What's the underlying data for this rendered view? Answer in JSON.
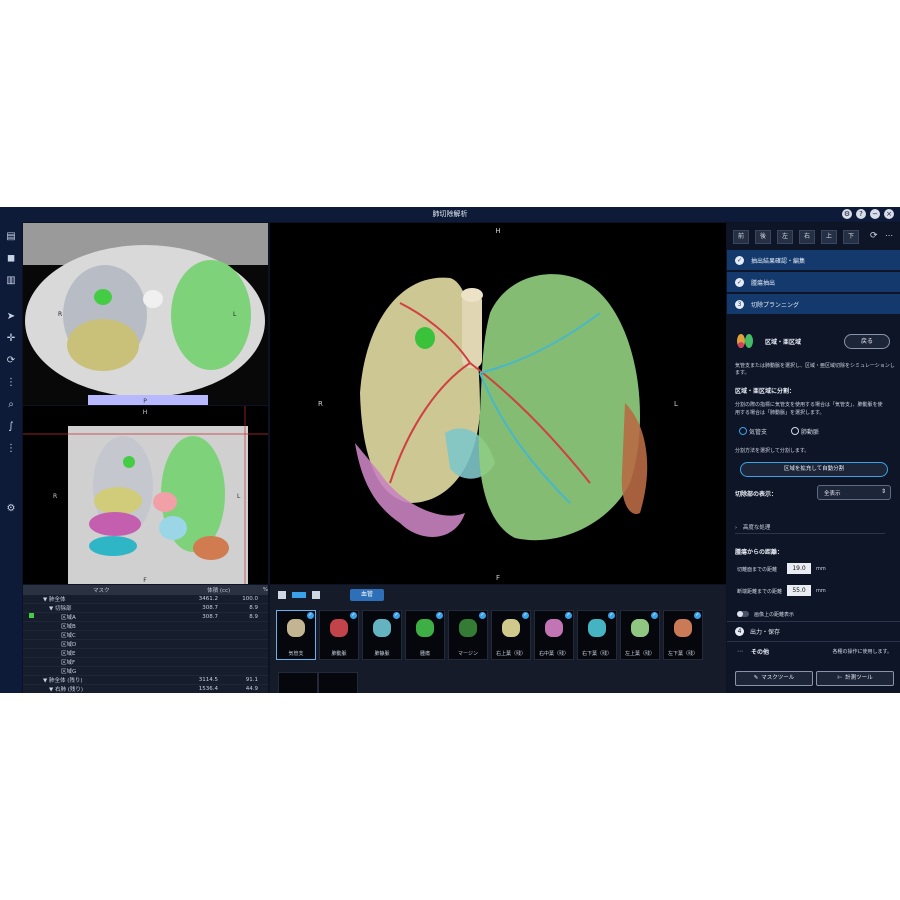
{
  "app": {
    "title": "肺切除解析",
    "window_controls": [
      "⚙",
      "?",
      "−",
      "×"
    ]
  },
  "toolbar_icons": [
    "patient-icon",
    "cube-icon",
    "report-icon",
    "pointer-icon",
    "pan-icon",
    "rotate-icon",
    "more-icon",
    "zoom-icon",
    "curve-icon",
    "more-icon",
    "settings-icon"
  ],
  "viewports": {
    "ct_axial": {
      "top": "P",
      "left": "R",
      "right": "L"
    },
    "coronal": {
      "top": "H",
      "left": "R",
      "right": "L",
      "bottom": "F"
    },
    "render3d": {
      "top": "H",
      "left": "R",
      "right": "L",
      "bottom": "F"
    }
  },
  "mask_table": {
    "headers": [
      "マスク",
      "体積 (cc)",
      "%"
    ],
    "rows": [
      {
        "name": "▼ 肺全体",
        "volume": "3461.2",
        "pct": "100.0"
      },
      {
        "name": "▼ 切除部",
        "volume": "308.7",
        "pct": "8.9"
      },
      {
        "name": "区域A",
        "volume": "308.7",
        "pct": "8.9"
      },
      {
        "name": "区域B",
        "volume": "",
        "pct": ""
      },
      {
        "name": "区域C",
        "volume": "",
        "pct": ""
      },
      {
        "name": "区域D",
        "volume": "",
        "pct": ""
      },
      {
        "name": "区域E",
        "volume": "",
        "pct": ""
      },
      {
        "name": "区域F",
        "volume": "",
        "pct": ""
      },
      {
        "name": "区域G",
        "volume": "",
        "pct": ""
      },
      {
        "name": "▼ 肺全体 (残り)",
        "volume": "3114.5",
        "pct": "91.1"
      },
      {
        "name": "▼ 右肺 (残り)",
        "volume": "1536.4",
        "pct": "44.9"
      }
    ]
  },
  "thumbs_toolbar": {
    "tab_label": "血管"
  },
  "thumbnails": [
    {
      "label": "気管支",
      "color": "#d8c9a0",
      "selected": true
    },
    {
      "label": "肺動脈",
      "color": "#d84a52",
      "selected": false
    },
    {
      "label": "肺静脈",
      "color": "#6fc7d4",
      "selected": false
    },
    {
      "label": "腫瘍",
      "color": "#45c24a",
      "selected": false
    },
    {
      "label": "マージン",
      "color": "#3a8a3a",
      "selected": false
    },
    {
      "label": "右上葉（残）",
      "color": "#e7df9a",
      "selected": false
    },
    {
      "label": "右中葉（残）",
      "color": "#d682c8",
      "selected": false
    },
    {
      "label": "右下葉（残）",
      "color": "#4ec7d6",
      "selected": false
    },
    {
      "label": "左上葉（残）",
      "color": "#9fdc8e",
      "selected": false
    },
    {
      "label": "左下葉（残）",
      "color": "#e0875e",
      "selected": false
    }
  ],
  "panel": {
    "direction_buttons": [
      "前",
      "後",
      "左",
      "右",
      "上",
      "下"
    ],
    "steps": [
      {
        "label": "抽出結果確認・編集",
        "marker": "✓"
      },
      {
        "label": "腫瘍抽出",
        "marker": "✓"
      },
      {
        "label": "切除プランニング",
        "marker": "3"
      }
    ],
    "section_title": "区域・亜区域",
    "back_button": "戻る",
    "description": "気管支または肺動脈を選択し、区域・亜区域切除をシミュレーションします。",
    "split_title": "区域・亜区域に分割：",
    "split_desc_1": "分割の際の指標に気管支を使用する場合は「気管支」、肺動脈を使",
    "split_desc_2": "用する場合は「肺動脈」を選択します。",
    "radio_bronchus": "気管支",
    "radio_artery": "肺動脈",
    "method_desc": "分割方法を選択して分割します。",
    "auto_split_button": "区域を拡充して自動分割",
    "display_label": "切除部の表示：",
    "display_value": "全表示",
    "advanced": "高度な処理",
    "distance_title": "腫瘍からの距離：",
    "distance_cut_label": "切離面までの距離",
    "distance_cut_value": "19.0",
    "distance_margin_label": "断端距離までの距離",
    "distance_margin_value": "55.0",
    "unit": "mm",
    "toggle_label": "画像上の距離表示",
    "step4": "出力・保存",
    "other_label": "その他",
    "other_desc": "各種の操作に使用します。",
    "mask_tool_button": "マスクツール",
    "measure_tool_button": "計測ツール"
  }
}
